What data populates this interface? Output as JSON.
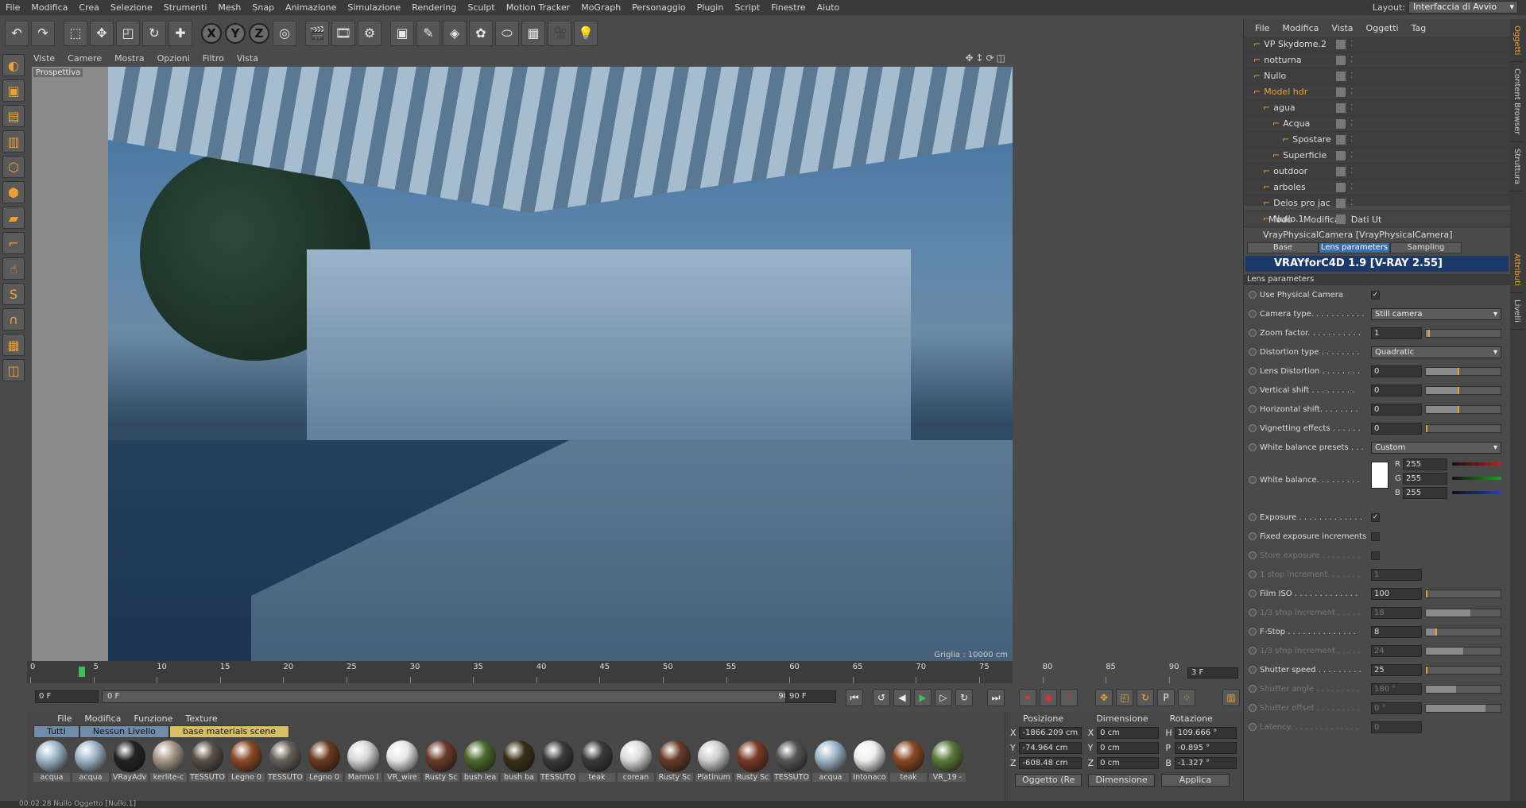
{
  "menubar": {
    "items": [
      "File",
      "Modifica",
      "Crea",
      "Selezione",
      "Strumenti",
      "Mesh",
      "Snap",
      "Animazione",
      "Simulazione",
      "Rendering",
      "Sculpt",
      "Motion Tracker",
      "MoGraph",
      "Personaggio",
      "Plugin",
      "Script",
      "Finestre",
      "Aiuto"
    ],
    "layout_label": "Layout:",
    "layout_value": "Interfaccia di Avvio"
  },
  "toolbar": {
    "axis": [
      "X",
      "Y",
      "Z"
    ]
  },
  "viewport": {
    "menu": [
      "Viste",
      "Camere",
      "Mostra",
      "Opzioni",
      "Filtro",
      "Vista"
    ],
    "label": "Prospettiva",
    "grid_label": "Griglia : 10000 cm"
  },
  "timeline": {
    "ticks": [
      "0",
      "5",
      "10",
      "15",
      "20",
      "25",
      "30",
      "35",
      "40",
      "45",
      "50",
      "55",
      "60",
      "65",
      "70",
      "75",
      "80",
      "85",
      "90"
    ],
    "current": "3",
    "frame_right": "3 F"
  },
  "transport": {
    "start": "0 F",
    "slider_left": "0 F",
    "slider_right": "90 F",
    "end": "90 F"
  },
  "materials": {
    "menu": [
      "File",
      "Modifica",
      "Funzione",
      "Texture"
    ],
    "tabs": [
      "Tutti",
      "Nessun Livello",
      "base materials scene"
    ],
    "items": [
      {
        "name": "acqua",
        "color": "#9fb7c9"
      },
      {
        "name": "acqua",
        "color": "#9fb7c9"
      },
      {
        "name": "VRayAdv",
        "color": "#222222"
      },
      {
        "name": "kerlite-c",
        "color": "#a99a88"
      },
      {
        "name": "TESSUTO",
        "color": "#5a5048"
      },
      {
        "name": "Legno 0",
        "color": "#8a4a24"
      },
      {
        "name": "TESSUTO",
        "color": "#676058"
      },
      {
        "name": "Legno 0",
        "color": "#6b3a1e"
      },
      {
        "name": "Marmo l",
        "color": "#d8d8d8"
      },
      {
        "name": "VR_wire",
        "color": "#e8e8e8"
      },
      {
        "name": "Rusty Sc",
        "color": "#6a3a28"
      },
      {
        "name": "bush lea",
        "color": "#4a6a2a"
      },
      {
        "name": "bush ba",
        "color": "#3a3018"
      },
      {
        "name": "TESSUTO",
        "color": "#3a3a3a"
      },
      {
        "name": "teak",
        "color": "#3a3a3a"
      },
      {
        "name": "corean",
        "color": "#dcdcdc"
      },
      {
        "name": "Rusty Sc",
        "color": "#6a3a28"
      },
      {
        "name": "Platinum",
        "color": "#cfcfcf"
      },
      {
        "name": "Rusty Sc",
        "color": "#7a3a26"
      },
      {
        "name": "TESSUTO",
        "color": "#555555"
      },
      {
        "name": "acqua",
        "color": "#9fb7c9"
      },
      {
        "name": "Intonaco",
        "color": "#eeeeee"
      },
      {
        "name": "teak",
        "color": "#8a4a22"
      },
      {
        "name": "VR_19 -",
        "color": "#5a7a3a"
      }
    ]
  },
  "coords": {
    "headers": [
      "Posizione",
      "Dimensione",
      "Rotazione"
    ],
    "rows": [
      {
        "axis": "X",
        "pos": "-1866.209 cm",
        "dax": "X",
        "dim": "0 cm",
        "rax": "H",
        "rot": "109.666 °"
      },
      {
        "axis": "Y",
        "pos": "-74.964 cm",
        "dax": "Y",
        "dim": "0 cm",
        "rax": "P",
        "rot": "-0.895 °"
      },
      {
        "axis": "Z",
        "pos": "-608.48 cm",
        "dax": "Z",
        "dim": "0 cm",
        "rax": "B",
        "rot": "-1.327 °"
      }
    ],
    "mode": "Oggetto (Re",
    "dim_mode": "Dimensione",
    "apply": "Applica"
  },
  "status": "00:02:28    Nullo Oggetto [Nullo.1]",
  "objects": {
    "menu": [
      "File",
      "Modifica",
      "Vista",
      "Oggetti",
      "Tag"
    ],
    "items": [
      {
        "name": "VP Skydome.2",
        "indent": 0,
        "hl": false
      },
      {
        "name": "notturna",
        "indent": 0,
        "hl": false
      },
      {
        "name": "Nullo",
        "indent": 0,
        "hl": false
      },
      {
        "name": "Model hdr",
        "indent": 0,
        "hl": true
      },
      {
        "name": "agua",
        "indent": 1,
        "hl": false
      },
      {
        "name": "Acqua",
        "indent": 2,
        "hl": false
      },
      {
        "name": "Spostare",
        "indent": 3,
        "hl": false
      },
      {
        "name": "Superficie",
        "indent": 2,
        "hl": false
      },
      {
        "name": "outdoor",
        "indent": 1,
        "hl": false
      },
      {
        "name": "arboles",
        "indent": 1,
        "hl": false
      },
      {
        "name": "Delos pro jac",
        "indent": 1,
        "hl": false
      },
      {
        "name": "Nullo.1",
        "indent": 1,
        "hl": false
      }
    ]
  },
  "attributes": {
    "menu": [
      "Modo",
      "Modifica",
      "Dati Ut"
    ],
    "title": "VrayPhysicalCamera [VrayPhysicalCamera]",
    "tabs": [
      "Base",
      "Lens parameters",
      "Sampling"
    ],
    "banner": "VRAYforC4D  1.9  [V-RAY 2.55]",
    "section": "Lens parameters",
    "params": [
      {
        "label": "Use Physical Camera",
        "type": "check",
        "value": "✓"
      },
      {
        "label": "Camera type. . . . . . . . . . .",
        "type": "drop",
        "value": "Still camera"
      },
      {
        "label": "Zoom factor. . . . . . . . . . .",
        "type": "num",
        "value": "1",
        "fill": 0.05
      },
      {
        "label": "Distortion type . . . . . . . .",
        "type": "drop",
        "value": "Quadratic"
      },
      {
        "label": "Lens Distortion . . . . . . . .",
        "type": "num",
        "value": "0",
        "fill": 0.45
      },
      {
        "label": "Vertical shift . . . . . . . . .",
        "type": "num",
        "value": "0",
        "fill": 0.45
      },
      {
        "label": "Horizontal shift. . . . . . . .",
        "type": "num",
        "value": "0",
        "fill": 0.45
      },
      {
        "label": "Vignetting effects . . . . . .",
        "type": "num",
        "value": "0",
        "fill": 0.02
      },
      {
        "label": "White balance presets . . .",
        "type": "drop",
        "value": "Custom"
      },
      {
        "label": "White balance. . . . . . . . .",
        "type": "rgb",
        "r": "255",
        "g": "255",
        "b": "255"
      },
      {
        "label": "Exposure . . . . . . . . . . . . .",
        "type": "check",
        "value": "✓"
      },
      {
        "label": "Fixed exposure increments",
        "type": "check",
        "value": ""
      },
      {
        "label": "Store exposure . . . . . . . .",
        "type": "check",
        "value": "",
        "dim": true
      },
      {
        "label": "1 stop increment. . . . . . .",
        "type": "num",
        "value": "1",
        "dim": true
      },
      {
        "label": "Film ISO . . . . . . . . . . . . .",
        "type": "num",
        "value": "100",
        "fill": 0.02
      },
      {
        "label": "1/3 stop increment . . . . .",
        "type": "num",
        "value": "18",
        "dim": true,
        "fill": 0.6
      },
      {
        "label": "F-Stop . . . . . . . . . . . . . .",
        "type": "num",
        "value": "8",
        "fill": 0.15
      },
      {
        "label": "1/3 stop increment . . . . .",
        "type": "num",
        "value": "24",
        "dim": true,
        "fill": 0.5
      },
      {
        "label": "Shutter speed . . . . . . . . .",
        "type": "num",
        "value": "25",
        "fill": 0.02
      },
      {
        "label": "Shutter angle . . . . . . . . .",
        "type": "num",
        "value": "180 °",
        "dim": true,
        "fill": 0.4
      },
      {
        "label": "Shutter offset . . . . . . . . .",
        "type": "num",
        "value": "0 °",
        "dim": true,
        "fill": 0.8
      },
      {
        "label": "Latency. . . . . . . . . . . . . .",
        "type": "num",
        "value": "0",
        "dim": true
      }
    ]
  },
  "side_tabs": [
    "Oggetti",
    "Content Browser",
    "Struttura"
  ],
  "side_tabs2": [
    "Attributi",
    "Livelli"
  ]
}
